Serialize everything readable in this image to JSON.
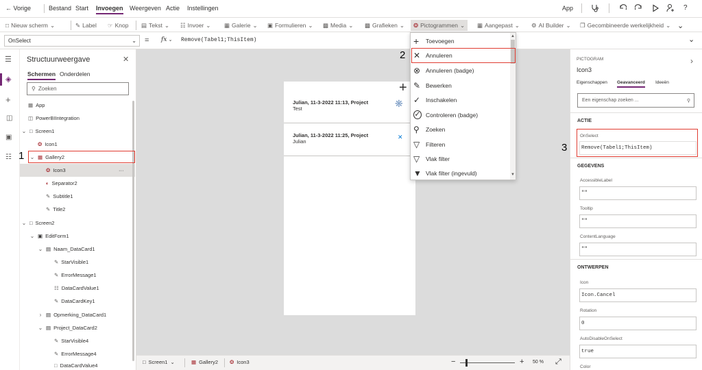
{
  "menubar": {
    "back": "Vorige",
    "items": [
      "Bestand",
      "Start",
      "Invoegen",
      "Weergeven",
      "Actie",
      "Instellingen"
    ],
    "active": "Invoegen",
    "app": "App"
  },
  "ribbon": {
    "new_screen": "Nieuw scherm",
    "label": "Label",
    "button": "Knop",
    "text": "Tekst",
    "input": "Invoer",
    "gallery": "Galerie",
    "forms": "Formulieren",
    "media": "Media",
    "charts": "Grafieken",
    "icons": "Pictogrammen",
    "custom": "Aangepast",
    "ai_builder": "AI Builder",
    "mixed_reality": "Gecombineerde werkelijkheid"
  },
  "formula": {
    "property": "OnSelect",
    "equals": "=",
    "fx": "fx",
    "expression": "Remove(Tabel1;ThisItem)"
  },
  "tree": {
    "title": "Structuurweergave",
    "tabs": [
      "Schermen",
      "Onderdelen"
    ],
    "search_placeholder": "Zoeken",
    "nodes": [
      {
        "label": "App",
        "icon": "app"
      },
      {
        "label": "PowerBIIntegration",
        "icon": "pbi"
      },
      {
        "label": "Screen1",
        "icon": "screen"
      },
      {
        "label": "Icon1",
        "icon": "icon"
      },
      {
        "label": "Gallery2",
        "icon": "gallery"
      },
      {
        "label": "Icon3",
        "icon": "icon"
      },
      {
        "label": "Separator2",
        "icon": "separator"
      },
      {
        "label": "Subtitle1",
        "icon": "label"
      },
      {
        "label": "Title2",
        "icon": "label"
      },
      {
        "label": "Screen2",
        "icon": "screen"
      },
      {
        "label": "EditForm1",
        "icon": "form"
      },
      {
        "label": "Naam_DataCard1",
        "icon": "card"
      },
      {
        "label": "StarVisible1",
        "icon": "label"
      },
      {
        "label": "ErrorMessage1",
        "icon": "label"
      },
      {
        "label": "DataCardValue1",
        "icon": "input"
      },
      {
        "label": "DataCardKey1",
        "icon": "label"
      },
      {
        "label": "Opmerking_DataCard1",
        "icon": "card"
      },
      {
        "label": "Project_DataCard2",
        "icon": "card"
      },
      {
        "label": "StarVisible4",
        "icon": "label"
      },
      {
        "label": "ErrorMessage4",
        "icon": "label"
      },
      {
        "label": "DataCardValue4",
        "icon": "input"
      }
    ],
    "more": "···"
  },
  "gallery": {
    "items": [
      {
        "title": "Julian, 11-3-2022 11:13, Project",
        "subtitle": "Test"
      },
      {
        "title": "Julian, 11-3-2022 11:25, Project",
        "subtitle": "Julian"
      }
    ],
    "add": "+"
  },
  "dropdown": {
    "items": [
      "Toevoegen",
      "Annuleren",
      "Annuleren (badge)",
      "Bewerken",
      "Inschakelen",
      "Controleren (badge)",
      "Zoeken",
      "Filteren",
      "Vlak filter",
      "Vlak filter (ingevuld)"
    ]
  },
  "statusbar": {
    "screen": "Screen1",
    "gallery": "Gallery2",
    "icon": "Icon3",
    "zoom_minus": "−",
    "zoom_plus": "+",
    "zoom_value": "50 %"
  },
  "props": {
    "type": "PICTOGRAM",
    "name": "Icon3",
    "tabs": [
      "Eigenschappen",
      "Geavanceerd",
      "Ideeën"
    ],
    "search_placeholder": "Een eigenschap zoeken ...",
    "section_action": "ACTIE",
    "onselect_label": "OnSelect",
    "onselect_value": "Remove(Tabel1;ThisItem)",
    "section_data": "GEGEVENS",
    "accessible_label": "AccessibleLabel",
    "accessible_value": "\"\"",
    "tooltip_label": "Tooltip",
    "tooltip_value": "\"\"",
    "content_lang_label": "ContentLanguage",
    "content_lang_value": "\"\"",
    "section_design": "ONTWERPEN",
    "icon_label": "Icon",
    "icon_value": "Icon.Cancel",
    "rotation_label": "Rotation",
    "rotation_value": "0",
    "autodisable_label": "AutoDisableOnSelect",
    "autodisable_value": "true",
    "color_label": "Color"
  },
  "annotations": [
    "1",
    "2",
    "3"
  ],
  "colors": {
    "accent": "#742774",
    "highlight": "#e03c31",
    "link": "#0078d4"
  }
}
